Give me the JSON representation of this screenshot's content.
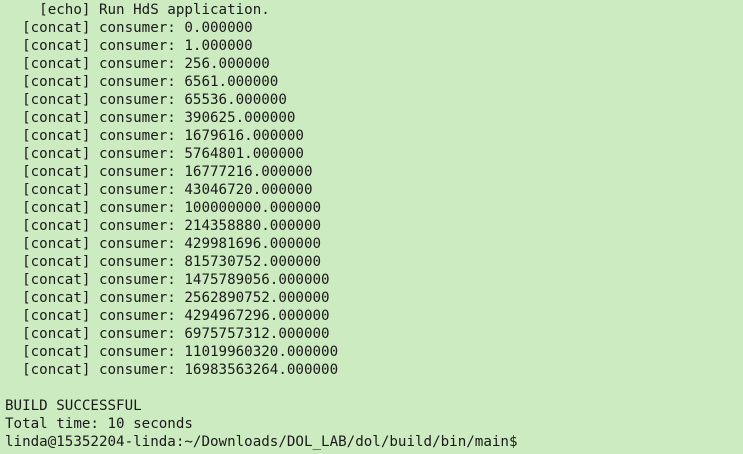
{
  "terminal": {
    "lines": [
      "    [echo] Run HdS application.",
      "  [concat] consumer: 0.000000",
      "  [concat] consumer: 1.000000",
      "  [concat] consumer: 256.000000",
      "  [concat] consumer: 6561.000000",
      "  [concat] consumer: 65536.000000",
      "  [concat] consumer: 390625.000000",
      "  [concat] consumer: 1679616.000000",
      "  [concat] consumer: 5764801.000000",
      "  [concat] consumer: 16777216.000000",
      "  [concat] consumer: 43046720.000000",
      "  [concat] consumer: 100000000.000000",
      "  [concat] consumer: 214358880.000000",
      "  [concat] consumer: 429981696.000000",
      "  [concat] consumer: 815730752.000000",
      "  [concat] consumer: 1475789056.000000",
      "  [concat] consumer: 2562890752.000000",
      "  [concat] consumer: 4294967296.000000",
      "  [concat] consumer: 6975757312.000000",
      "  [concat] consumer: 11019960320.000000",
      "  [concat] consumer: 16983563264.000000",
      "",
      "BUILD SUCCESSFUL",
      "Total time: 10 seconds"
    ],
    "prompt": "linda@15352204-linda:~/Downloads/DOL_LAB/dol/build/bin/main$"
  },
  "colors": {
    "background": "#cdebc0",
    "text": "#1a1a1a"
  }
}
